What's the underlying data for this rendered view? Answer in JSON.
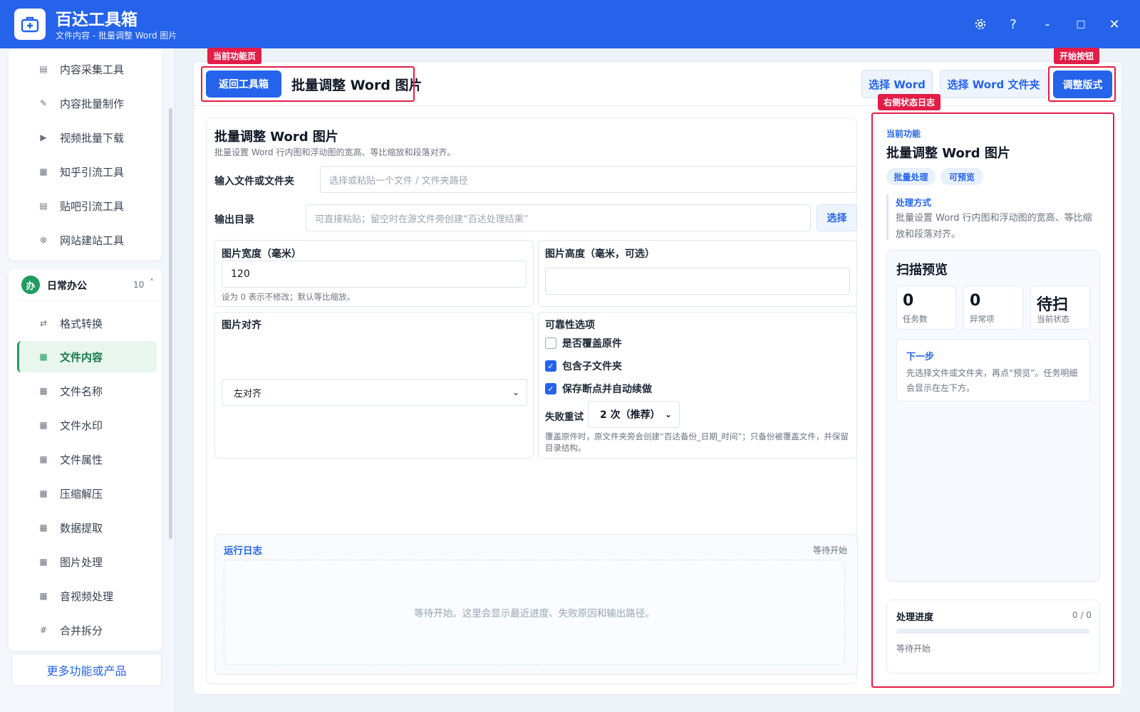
{
  "app": {
    "title": "百达工具箱",
    "subtitle": "文件内容 - 批量调整 Word 图片",
    "brand_color": "#2563eb"
  },
  "window_controls": {
    "settings_icon": "gear-icon",
    "help": "?",
    "minimize": "-",
    "maximize": "□",
    "close": "✕"
  },
  "sidebar": {
    "top_items": [
      {
        "label": "内容采集工具",
        "icon": "▤"
      },
      {
        "label": "内容批量制作",
        "icon": "✎"
      },
      {
        "label": "视频批量下载",
        "icon": "▶"
      },
      {
        "label": "知乎引流工具",
        "icon": "▦"
      },
      {
        "label": "贴吧引流工具",
        "icon": "▤"
      },
      {
        "label": "网站建站工具",
        "icon": "⊗"
      }
    ],
    "group": {
      "badge": "办",
      "title": "日常办公",
      "count": "10",
      "caret": "˄"
    },
    "group_items": [
      {
        "label": "格式转换",
        "icon": "⇄"
      },
      {
        "label": "文件内容",
        "icon": "▦"
      },
      {
        "label": "文件名称",
        "icon": "▦"
      },
      {
        "label": "文件水印",
        "icon": "▦"
      },
      {
        "label": "文件属性",
        "icon": "▦"
      },
      {
        "label": "压缩解压",
        "icon": "▦"
      },
      {
        "label": "数据提取",
        "icon": "▦"
      },
      {
        "label": "图片处理",
        "icon": "▦"
      },
      {
        "label": "音视频处理",
        "icon": "▦"
      },
      {
        "label": "合并拆分",
        "icon": "#"
      }
    ],
    "active_item": "文件内容",
    "more_button": "更多功能或产品"
  },
  "annotations": {
    "current_page": "当前功能页",
    "start_button": "开始按钮",
    "right_log": "右侧状态日志"
  },
  "toolbar": {
    "back_button": "返回工具箱",
    "page_title": "批量调整 Word 图片",
    "select_word": "选择 Word",
    "select_folder": "选择 Word 文件夹",
    "start_button": "调整版式"
  },
  "form": {
    "title": "批量调整 Word 图片",
    "description": "批量设置 Word 行内图和浮动图的宽高、等比缩放和段落对齐。",
    "input_label": "输入文件或文件夹",
    "input_placeholder": "选择或粘贴一个文件 / 文件夹路径",
    "output_label": "输出目录",
    "output_placeholder": "可直接粘贴；留空时在源文件旁创建“百达处理结果”",
    "output_select_button": "选择",
    "width_label": "图片宽度（毫米）",
    "width_value": "120",
    "width_hint": "设为 0 表示不修改；默认等比缩放。",
    "height_label": "图片高度（毫米，可选）",
    "height_value": "",
    "align_label": "图片对齐",
    "align_value": "左对齐",
    "reliability_label": "可靠性选项",
    "options": [
      {
        "label": "是否覆盖原件",
        "checked": false
      },
      {
        "label": "包含子文件夹",
        "checked": true
      },
      {
        "label": "保存断点并自动续做",
        "checked": true
      }
    ],
    "retry_label": "失败重试",
    "retry_value": "2 次（推荐）",
    "backup_hint": "覆盖原件时，原文件夹旁会创建“百达备份_日期_时间”；只备份被覆盖文件，并保留目录结构。"
  },
  "log": {
    "title": "运行日志",
    "status": "等待开始",
    "placeholder": "等待开始。这里会显示最近进度、失败原因和输出路径。"
  },
  "right_panel": {
    "current_label": "当前功能",
    "title": "批量调整 Word 图片",
    "chips": [
      "批量处理",
      "可预览"
    ],
    "method_title": "处理方式",
    "method_text": "批量设置 Word 行内图和浮动图的宽高、等比缩放和段落对齐。",
    "scan_title": "扫描预览",
    "stats": [
      {
        "value": "0",
        "label": "任务数"
      },
      {
        "value": "0",
        "label": "异常项"
      },
      {
        "value": "待扫",
        "label": "当前状态"
      }
    ],
    "next_title": "下一步",
    "next_text": "先选择文件或文件夹，再点“预览”。任务明细会显示在左下方。",
    "progress_title": "处理进度",
    "progress_count": "0 / 0",
    "progress_fraction": 0,
    "progress_status": "等待开始"
  }
}
